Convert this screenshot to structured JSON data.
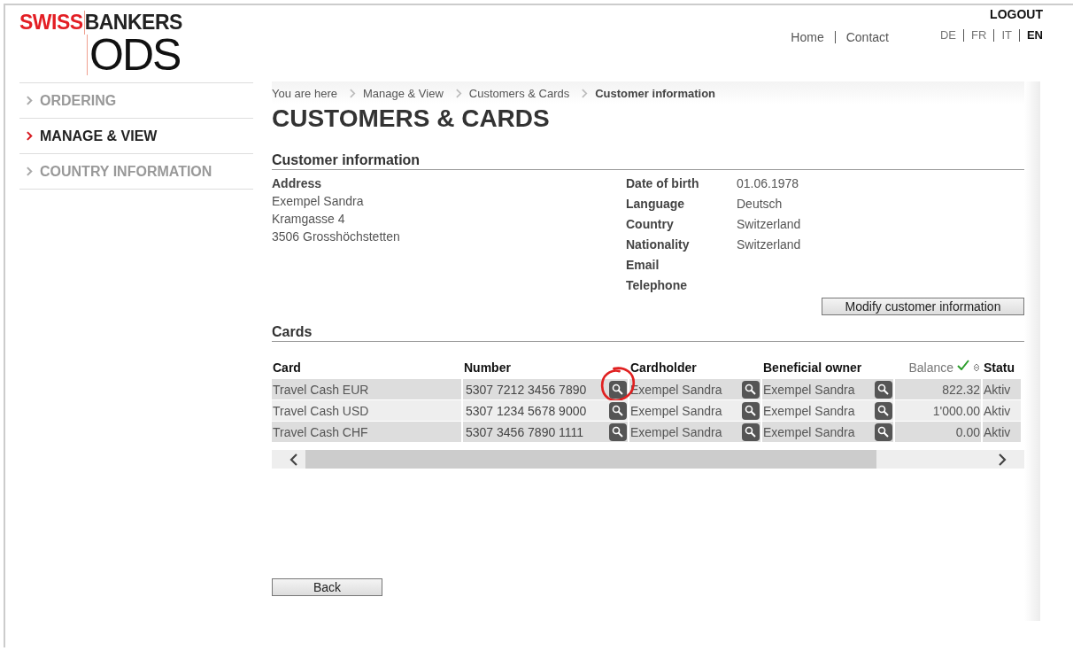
{
  "logo": {
    "brand_red": "SWISS",
    "brand_dark": "BANKERS",
    "product": "ODS"
  },
  "header": {
    "logout": "LOGOUT",
    "links": [
      "Home",
      "Contact"
    ],
    "languages": [
      {
        "label": "DE",
        "selected": false
      },
      {
        "label": "FR",
        "selected": false
      },
      {
        "label": "IT",
        "selected": false
      },
      {
        "label": "EN",
        "selected": true
      }
    ]
  },
  "sidebar": {
    "items": [
      {
        "label": "ORDERING",
        "selected": false
      },
      {
        "label": "MANAGE & VIEW",
        "selected": true
      },
      {
        "label": "COUNTRY INFORMATION",
        "selected": false
      }
    ]
  },
  "breadcrumb": [
    "You are here",
    "Manage & View",
    "Customers & Cards",
    "Customer information"
  ],
  "page_title": "CUSTOMERS & CARDS",
  "customer_section": {
    "title": "Customer information",
    "address_label": "Address",
    "address_lines": [
      "Exempel Sandra",
      "Kramgasse 4",
      "3506 Grosshöchstetten"
    ],
    "fields": [
      {
        "label": "Date of birth",
        "value": "01.06.1978"
      },
      {
        "label": "Language",
        "value": "Deutsch"
      },
      {
        "label": "Country",
        "value": "Switzerland"
      },
      {
        "label": "Nationality",
        "value": "Switzerland"
      },
      {
        "label": "Email"
      },
      {
        "label": "Telephone"
      }
    ],
    "modify_button": "Modify customer information"
  },
  "cards_section": {
    "title": "Cards",
    "columns": [
      "Card",
      "Number",
      "Cardholder",
      "Beneficial owner",
      "Balance",
      "Statu"
    ],
    "rows": [
      {
        "card": "Travel Cash EUR",
        "number": "5307 7212 3456 7890",
        "cardholder": "Exempel Sandra",
        "owner": "Exempel Sandra",
        "balance": "822.32",
        "status": "Aktiv",
        "highlighted": true
      },
      {
        "card": "Travel Cash USD",
        "number": "5307 1234 5678 9000",
        "cardholder": "Exempel Sandra",
        "owner": "Exempel Sandra",
        "balance": "1'000.00",
        "status": "Aktiv",
        "highlighted": false
      },
      {
        "card": "Travel Cash CHF",
        "number": "5307 3456 7890 1111",
        "cardholder": "Exempel Sandra",
        "owner": "Exempel Sandra",
        "balance": "0.00",
        "status": "Aktiv",
        "highlighted": false
      }
    ]
  },
  "back_button": "Back"
}
